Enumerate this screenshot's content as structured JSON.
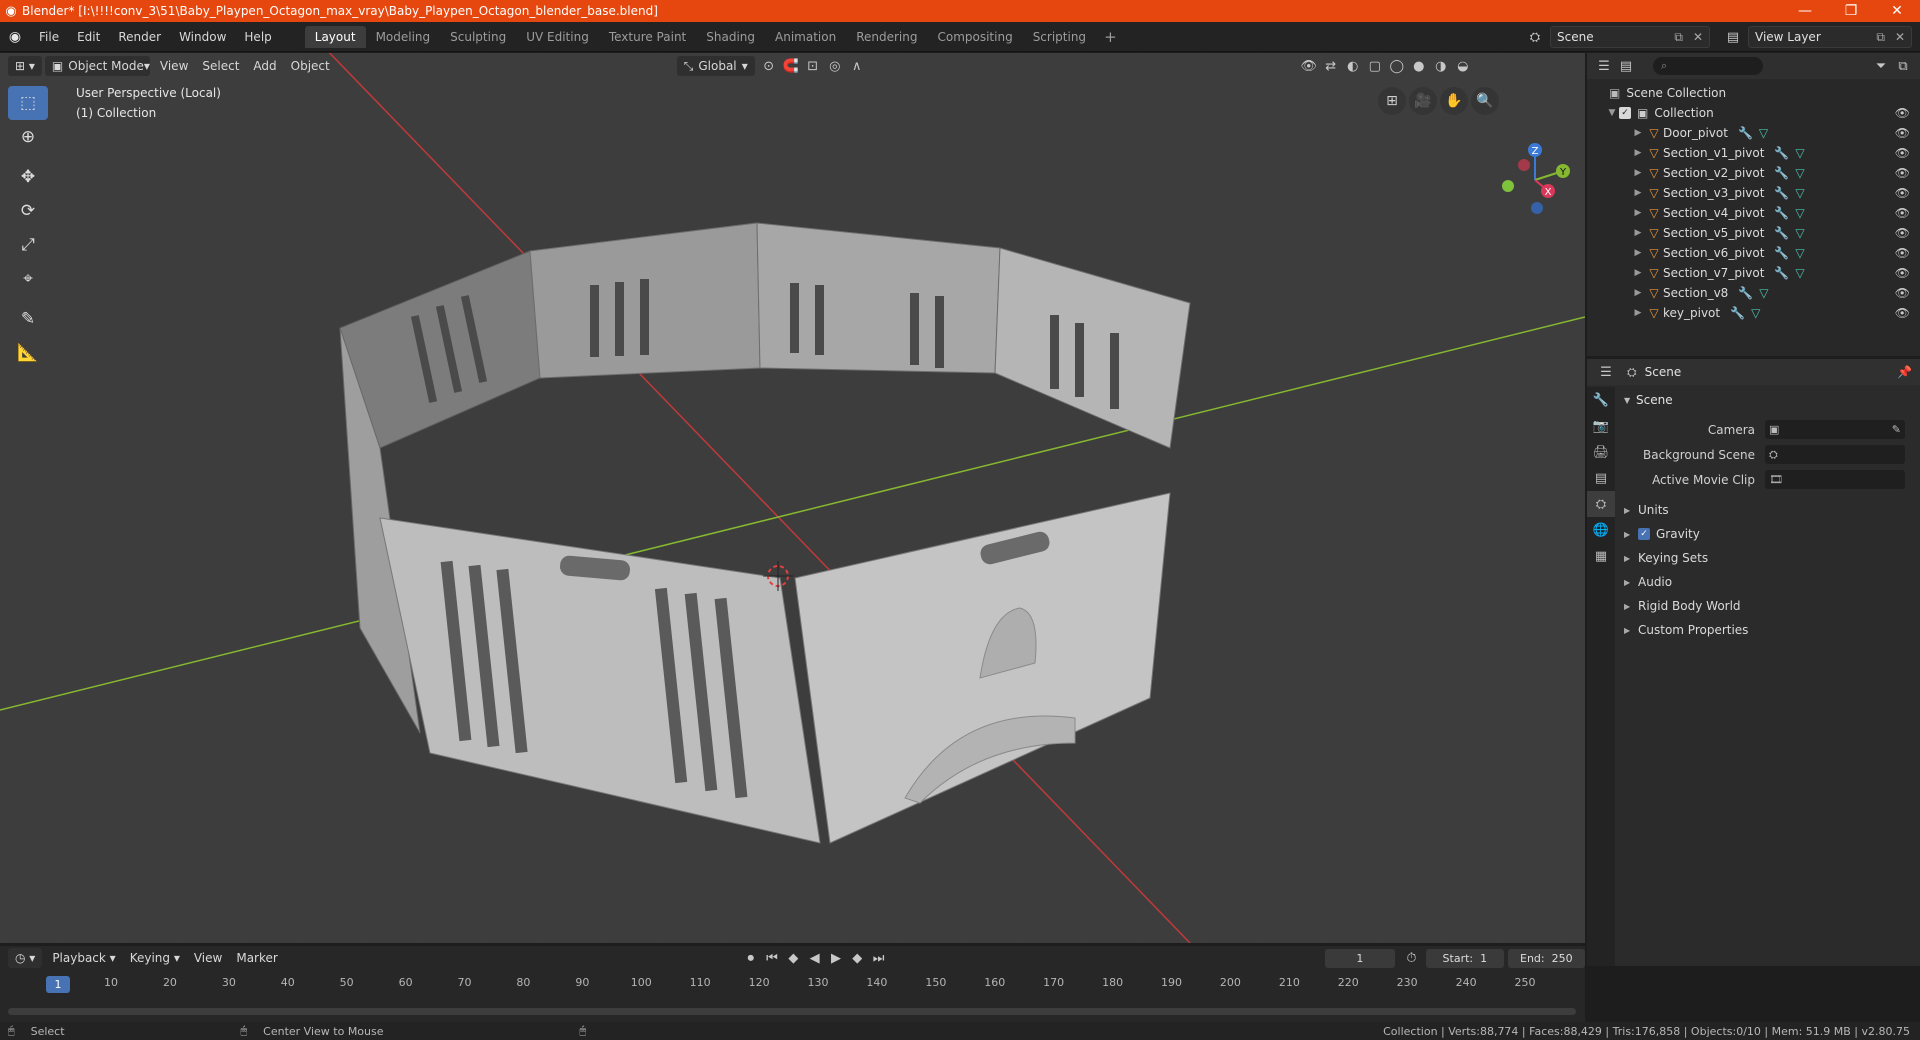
{
  "window": {
    "title": "Blender* [I:\\!!!!conv_3\\51\\Baby_Playpen_Octagon_max_vray\\Baby_Playpen_Octagon_blender_base.blend]",
    "controls": [
      "minimize-icon",
      "maximize-icon",
      "close-icon"
    ]
  },
  "menu": [
    "File",
    "Edit",
    "Render",
    "Window",
    "Help"
  ],
  "workspaces": [
    "Layout",
    "Modeling",
    "Sculpting",
    "UV Editing",
    "Texture Paint",
    "Shading",
    "Animation",
    "Rendering",
    "Compositing",
    "Scripting"
  ],
  "active_workspace": "Layout",
  "scene_selector": "Scene",
  "view_layer": "View Layer",
  "viewport": {
    "mode": "Object Mode",
    "menus": [
      "View",
      "Select",
      "Add",
      "Object"
    ],
    "orientation": "Global",
    "info_line1": "User Perspective (Local)",
    "info_line2": "(1) Collection",
    "background_color": "#3d3d3d",
    "axis_x_color": "#c0393b",
    "axis_y_color": "#86b830",
    "gizmo_labels": {
      "x": "X",
      "y": "Y",
      "z": "Z"
    }
  },
  "outliner": {
    "root": "Scene Collection",
    "collection": "Collection",
    "objects": [
      "Door_pivot",
      "Section_v1_pivot",
      "Section_v2_pivot",
      "Section_v3_pivot",
      "Section_v4_pivot",
      "Section_v5_pivot",
      "Section_v6_pivot",
      "Section_v7_pivot",
      "Section_v8",
      "key_pivot"
    ]
  },
  "properties": {
    "header": "Scene",
    "panel_title": "Scene",
    "camera_label": "Camera",
    "background_scene_label": "Background Scene",
    "active_movie_clip_label": "Active Movie Clip",
    "subpanels": [
      "Units",
      "Gravity",
      "Keying Sets",
      "Audio",
      "Rigid Body World",
      "Custom Properties"
    ]
  },
  "timeline": {
    "menus": [
      "Playback",
      "Keying",
      "View",
      "Marker"
    ],
    "current_frame": "1",
    "start_label": "Start:",
    "start": "1",
    "end_label": "End:",
    "end": "250",
    "ticks": [
      "1",
      "10",
      "20",
      "30",
      "40",
      "50",
      "60",
      "70",
      "80",
      "90",
      "100",
      "110",
      "120",
      "130",
      "140",
      "150",
      "160",
      "170",
      "180",
      "190",
      "200",
      "210",
      "220",
      "230",
      "240",
      "250"
    ]
  },
  "statusbar": {
    "select": "Select",
    "center_view": "Center View to Mouse",
    "stats": "Collection | Verts:88,774 | Faces:88,429 | Tris:176,858 | Objects:0/10 | Mem: 51.9 MB | v2.80.75"
  }
}
